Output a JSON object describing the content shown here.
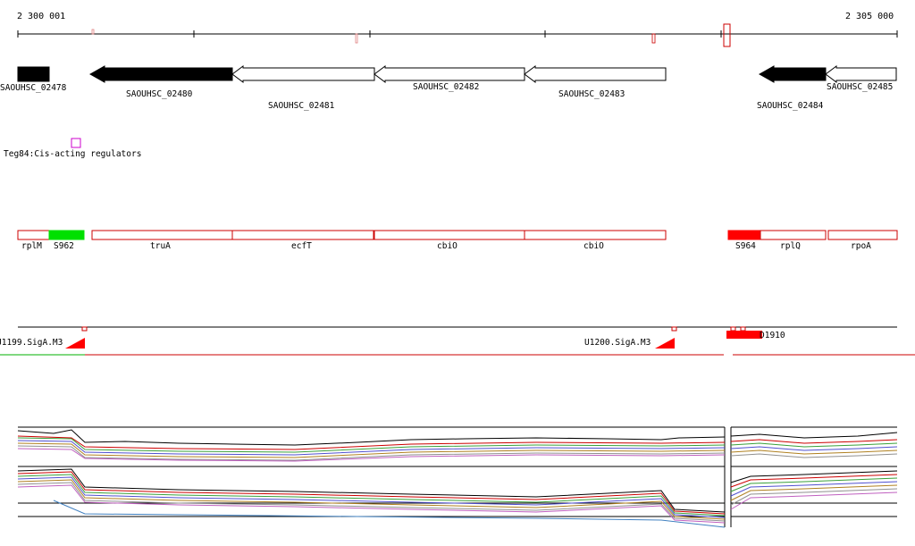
{
  "ruler": {
    "start_label": "2 300 001",
    "end_label": "2 305 000"
  },
  "genes": [
    {
      "id": "SAOUHSC_02478",
      "label": "SAOUHSC_02478",
      "strand": "-",
      "filled": true
    },
    {
      "id": "SAOUHSC_02480",
      "label": "SAOUHSC_02480",
      "strand": "-",
      "filled": true
    },
    {
      "id": "SAOUHSC_02481",
      "label": "SAOUHSC_02481",
      "strand": "-",
      "filled": false
    },
    {
      "id": "SAOUHSC_02482",
      "label": "SAOUHSC_02482",
      "strand": "-",
      "filled": false
    },
    {
      "id": "SAOUHSC_02483",
      "label": "SAOUHSC_02483",
      "strand": "-",
      "filled": false
    },
    {
      "id": "SAOUHSC_02484",
      "label": "SAOUHSC_02484",
      "strand": "-",
      "filled": true
    },
    {
      "id": "SAOUHSC_02485",
      "label": "SAOUHSC_02485",
      "strand": "-",
      "filled": false
    }
  ],
  "regulator": {
    "label": "Teg84:Cis-acting regulators"
  },
  "features": [
    {
      "label": "rplM",
      "color": "#ffffff"
    },
    {
      "label": "S962",
      "color": "#00e000"
    },
    {
      "label": "truA",
      "color": "#ffffff"
    },
    {
      "label": "ecfT",
      "color": "#ffffff"
    },
    {
      "label": "cbiO",
      "color": "#ffffff"
    },
    {
      "label": "cbiO",
      "color": "#ffffff"
    },
    {
      "label": "S964",
      "color": "#ff0000"
    },
    {
      "label": "rplQ",
      "color": "#ffffff"
    },
    {
      "label": "rpoA",
      "color": "#ffffff"
    }
  ],
  "promoters": [
    {
      "label": "U1199.SigA.M3"
    },
    {
      "label": "U1200.SigA.M3"
    },
    {
      "label": "D1910"
    }
  ],
  "colors": {
    "feature_border": "#cc0000",
    "promoter_line": "#cc0000",
    "highlight": "#ff0000",
    "green": "#00e000",
    "regulator_box": "#cc00cc"
  }
}
